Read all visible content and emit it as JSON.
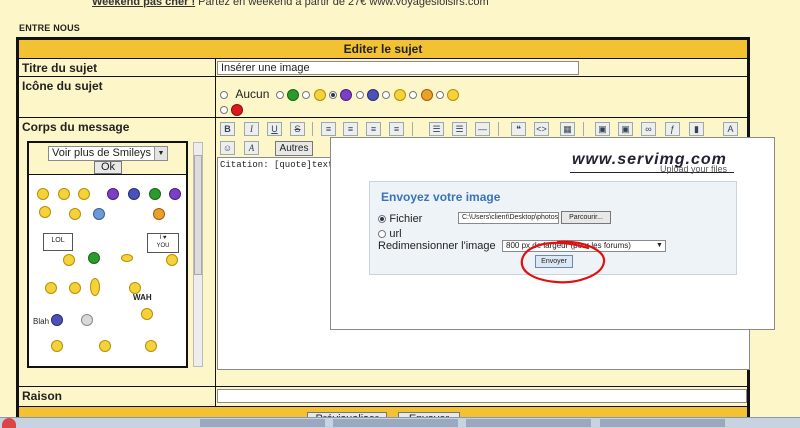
{
  "promo": {
    "bold": "Weekend pas cher !",
    "text": " Partez en weekend à partir de 27€ www.voyagesloisirs.com"
  },
  "section_label": "ENTRE NOUS",
  "header": {
    "title": "Editer le sujet"
  },
  "form": {
    "title_label": "Titre du sujet",
    "title_value": "Insérer une image",
    "icon_label": "Icône du sujet",
    "icon_none_label": "Aucun",
    "body_label": "Corps du message",
    "reason_label": "Raison"
  },
  "smileys": {
    "more_label": "Voir plus de Smileys",
    "ok_label": "Ok"
  },
  "toolbar": {
    "bold": "B",
    "italic": "I",
    "underline": "U",
    "strike": "S",
    "others_label": "Autres"
  },
  "editor": {
    "citation_text": "Citation: [quote]texte cit"
  },
  "servimg": {
    "logo": "www.servimg.com",
    "tagline": "Upload your files",
    "title": "Envoyez votre image",
    "file_label": "Fichier",
    "file_path": "C:\\Users\\client\\Desktop\\photos\\deco",
    "browse_label": "Parcourir...",
    "url_label": "url",
    "resize_label": "Redimensionner l'image",
    "resize_value": "800 px de largeur (pour les forums)",
    "send_label": "Envoyer"
  },
  "footer": {
    "preview_label": "Prévisualiser",
    "send_label": "Envoyer"
  },
  "colors": {
    "header_bg": "#f3c233",
    "page_bg": "#fdf6c9",
    "servimg_blue": "#3a73b8",
    "annotation_red": "#e01010"
  }
}
